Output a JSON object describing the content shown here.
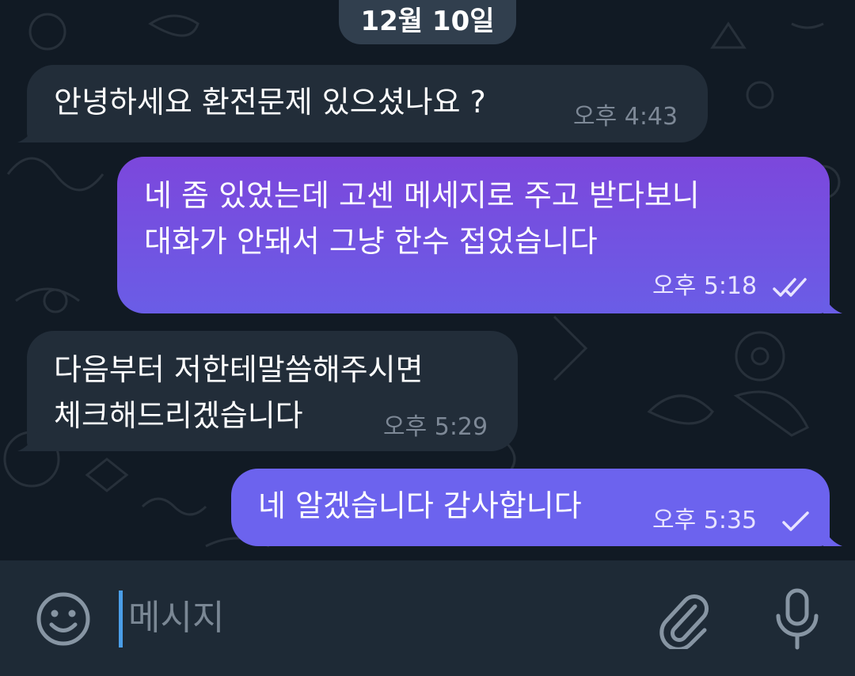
{
  "date_label": "12월 10일",
  "messages": [
    {
      "direction": "incoming",
      "lines": [
        "안녕하세요 환전문제 있으셨나요 ?"
      ],
      "time": "오후 4:43"
    },
    {
      "direction": "outgoing",
      "lines": [
        "네 좀 있었는데 고센 메세지로 주고 받다보니",
        "대화가 안돼서 그냥 한수 접었습니다"
      ],
      "time": "오후 5:18",
      "status": "read",
      "status_icon": "double-check-icon"
    },
    {
      "direction": "incoming",
      "lines": [
        "다음부터 저한테말씀해주시면",
        "체크해드리겠습니다"
      ],
      "time": "오후 5:29"
    },
    {
      "direction": "outgoing",
      "lines": [
        "네 알겠습니다 감사합니다"
      ],
      "time": "오후 5:35",
      "status": "sent",
      "status_icon": "single-check-icon"
    }
  ],
  "composer": {
    "placeholder": "메시지",
    "emoji_icon": "smiley-icon",
    "attach_icon": "paperclip-icon",
    "voice_icon": "microphone-icon"
  },
  "colors": {
    "chat_background": "#111a24",
    "incoming_bubble": "#222d39",
    "outgoing_gradient_top": "#7c47dc",
    "outgoing_gradient_bottom": "#6a5de6",
    "input_bar": "#1e2a36",
    "cursor": "#4a9ee8"
  }
}
